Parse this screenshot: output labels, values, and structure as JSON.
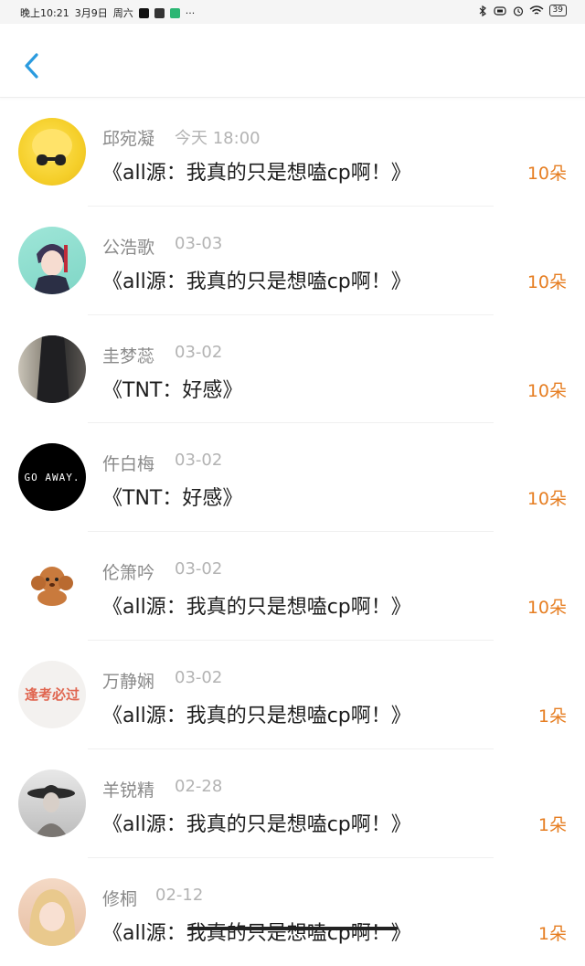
{
  "status_bar": {
    "time": "晚上10:21",
    "date": "3月9日",
    "weekday": "周六",
    "more": "···",
    "battery": "39",
    "app_icons": [
      "tiktok-icon",
      "app-icon",
      "shield-app-icon"
    ],
    "right_icons": [
      "bluetooth-icon",
      "vibrate-icon",
      "alarm-icon",
      "wifi-icon"
    ]
  },
  "header": {
    "back_icon": "chevron-left-icon",
    "accent_color": "#2b9bdf"
  },
  "list": [
    {
      "name": "邱宛凝",
      "time": "今天 18:00",
      "title": "《all源：我真的只是想嗑cp啊！》",
      "count": "10朵",
      "avatar": "yellow-bird"
    },
    {
      "name": "公浩歌",
      "time": "03-03",
      "title": "《all源：我真的只是想嗑cp啊！》",
      "count": "10朵",
      "avatar": "anime-boy"
    },
    {
      "name": "圭梦蕊",
      "time": "03-02",
      "title": "《TNT：好感》",
      "count": "10朵",
      "avatar": "dark-hair"
    },
    {
      "name": "仵白梅",
      "time": "03-02",
      "title": "《TNT：好感》",
      "count": "10朵",
      "avatar": "go-away",
      "avatar_text": "GO AWAY."
    },
    {
      "name": "伦箫吟",
      "time": "03-02",
      "title": "《all源：我真的只是想嗑cp啊！》",
      "count": "10朵",
      "avatar": "poodle"
    },
    {
      "name": "万静娴",
      "time": "03-02",
      "title": "《all源：我真的只是想嗑cp啊！》",
      "count": "1朵",
      "avatar": "red-text",
      "avatar_text": "逢考必过"
    },
    {
      "name": "羊锐精",
      "time": "02-28",
      "title": "《all源：我真的只是想嗑cp啊！》",
      "count": "1朵",
      "avatar": "hat-woman"
    },
    {
      "name": "修桐",
      "time": "02-12",
      "title": "《all源：我真的只是想嗑cp啊！》",
      "count": "1朵",
      "avatar": "blonde-girl"
    }
  ],
  "colors": {
    "count": "#e67e22",
    "name": "#8a8a8a",
    "time": "#b3b3b3"
  }
}
